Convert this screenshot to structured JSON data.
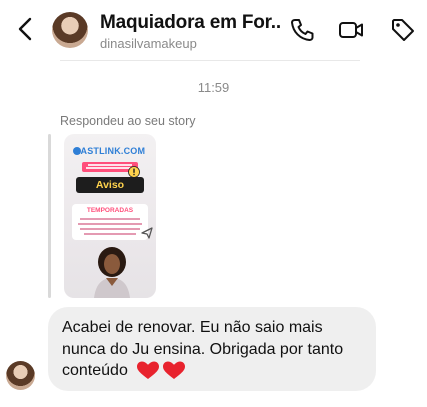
{
  "header": {
    "contact_name": "Maquiadora em For...",
    "handle": "dinasilvamakeup",
    "icons": [
      "back-chevron-icon",
      "phone-icon",
      "video-camera-icon",
      "tag-icon"
    ]
  },
  "conversation": {
    "timestamp": "11:59",
    "reply_context": "Respondeu ao seu story",
    "story": {
      "logo_text": "LASTLINK.COM",
      "banner_text": "Aviso",
      "heading": "TEMPORADAS"
    },
    "message": {
      "text": "Acabei de renovar. Eu não saio mais nunca do Ju ensina. Obrigada por tanto conteúdo",
      "emoji": "❤️❤️"
    }
  },
  "colors": {
    "bubble": "#efefef",
    "secondary_text": "#8a8a8a",
    "story_accent_pink": "#ff4f7b",
    "story_logo_blue": "#2f7fd6"
  }
}
